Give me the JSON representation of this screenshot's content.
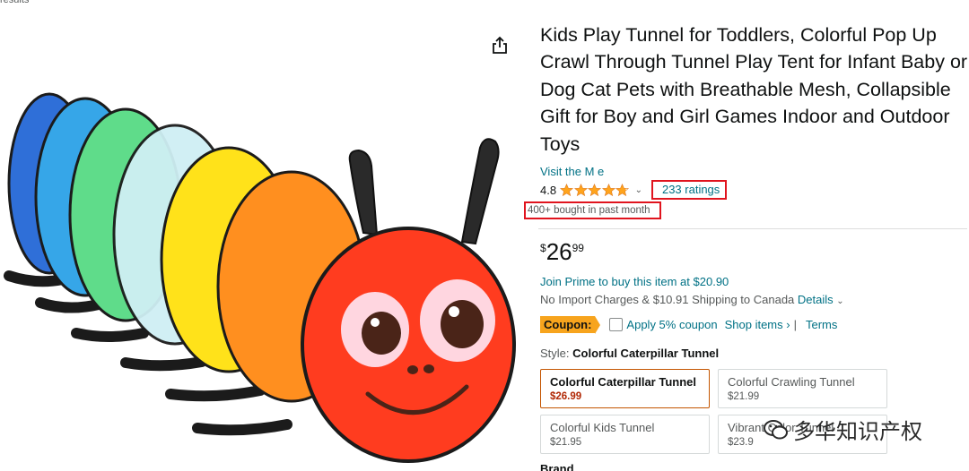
{
  "header": {
    "results_crumb": "results"
  },
  "product": {
    "title": "Kids Play Tunnel for Toddlers, Colorful Pop Up Crawl Through Tunnel Play Tent for Infant Baby or Dog Cat Pets with Breathable Mesh, Collapsible Gift for Boy and Girl Games Indoor and Outdoor Toys",
    "store_link": "Visit the M          e",
    "rating_value": "4.8",
    "rating_stars": 4.8,
    "ratings_count": "233 ratings",
    "bought": "400+ bought in past month",
    "price": {
      "symbol": "$",
      "whole": "26",
      "fraction": "99"
    },
    "prime": "Join Prime to buy this item at $20.90",
    "shipping": "No Import Charges & $10.91 Shipping to Canada ",
    "shipping_details": "Details",
    "coupon": {
      "badge": "Coupon:",
      "apply": "Apply 5% coupon",
      "shop": "Shop items ›",
      "sep": "|",
      "terms": "Terms"
    },
    "style_label": "Style: ",
    "style_value": "Colorful Caterpillar Tunnel",
    "options": [
      {
        "name": "Colorful Caterpillar Tunnel",
        "price": "$26.99"
      },
      {
        "name": "Colorful Crawling Tunnel",
        "price": "$21.99"
      },
      {
        "name": "Colorful Kids Tunnel",
        "price": "$21.95"
      },
      {
        "name": "Vibrant Color Tunnel",
        "price": "$23.9"
      }
    ],
    "brand_label": "Brand"
  },
  "watermark": "多华知识产权",
  "colors": {
    "link": "#007185",
    "highlight_box": "#e0141e",
    "star": "#ffa41c",
    "coupon": "#f7a41d"
  }
}
